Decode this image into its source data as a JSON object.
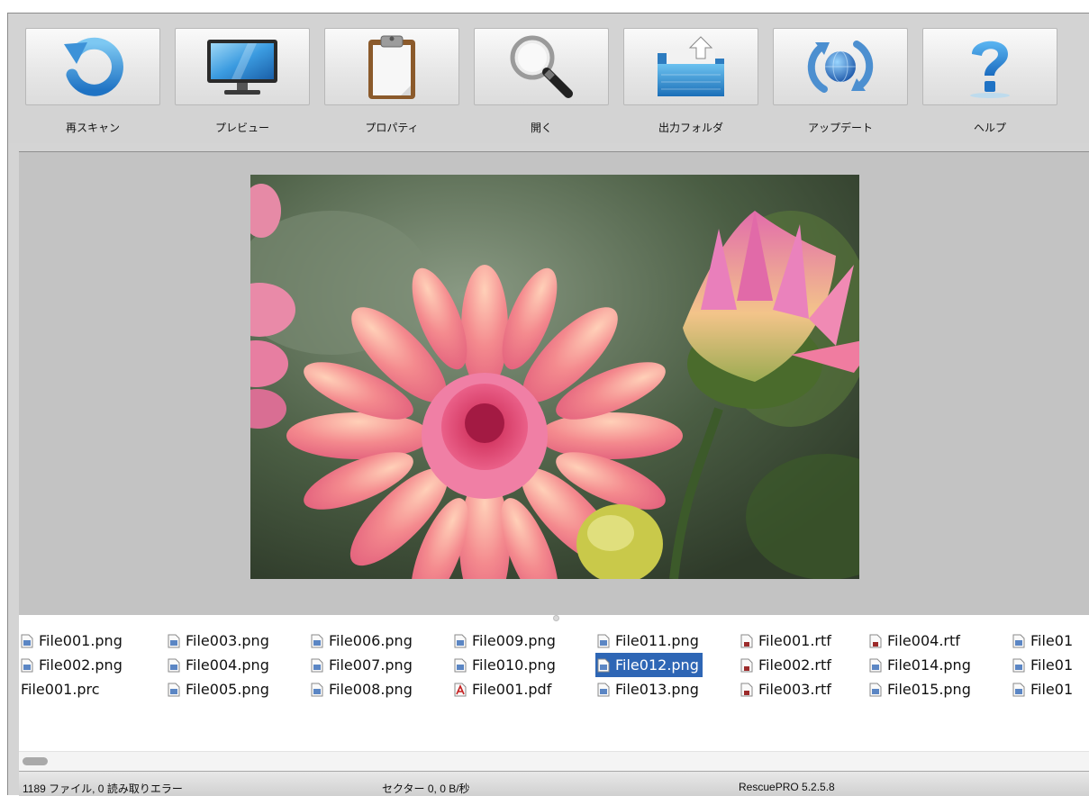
{
  "toolbar": {
    "buttons": [
      {
        "label": "再スキャン",
        "icon": "rescan-icon"
      },
      {
        "label": "プレビュー",
        "icon": "monitor-icon"
      },
      {
        "label": "プロパティ",
        "icon": "clipboard-icon"
      },
      {
        "label": "開く",
        "icon": "magnifier-icon"
      },
      {
        "label": "出力フォルダ",
        "icon": "folder-export-icon"
      },
      {
        "label": "アップデート",
        "icon": "update-globe-icon"
      },
      {
        "label": "ヘルプ",
        "icon": "help-question-icon"
      }
    ]
  },
  "preview": {
    "image": "pink-dahlia-flowers-photo"
  },
  "files": {
    "selected": "File012.png",
    "columns": [
      [
        "File001.png",
        "File002.png",
        "File001.prc"
      ],
      [
        "File003.png",
        "File004.png",
        "File005.png"
      ],
      [
        "File006.png",
        "File007.png",
        "File008.png"
      ],
      [
        "File009.png",
        "File010.png",
        "File001.pdf"
      ],
      [
        "File011.png",
        "File012.png",
        "File013.png"
      ],
      [
        "File001.rtf",
        "File002.rtf",
        "File003.rtf"
      ],
      [
        "File004.rtf",
        "File014.png",
        "File015.png"
      ],
      [
        "File01",
        "File01",
        "File01"
      ]
    ]
  },
  "status": {
    "files": "1189 ファイル, 0 読み取りエラー",
    "sector": "セクター 0, 0 B/秒",
    "version": "RescuePRO 5.2.5.8"
  },
  "colors": {
    "selection": "#2e66b5",
    "toolbar_bg": "#d3d3d3",
    "preview_bg": "#c3c3c3"
  }
}
